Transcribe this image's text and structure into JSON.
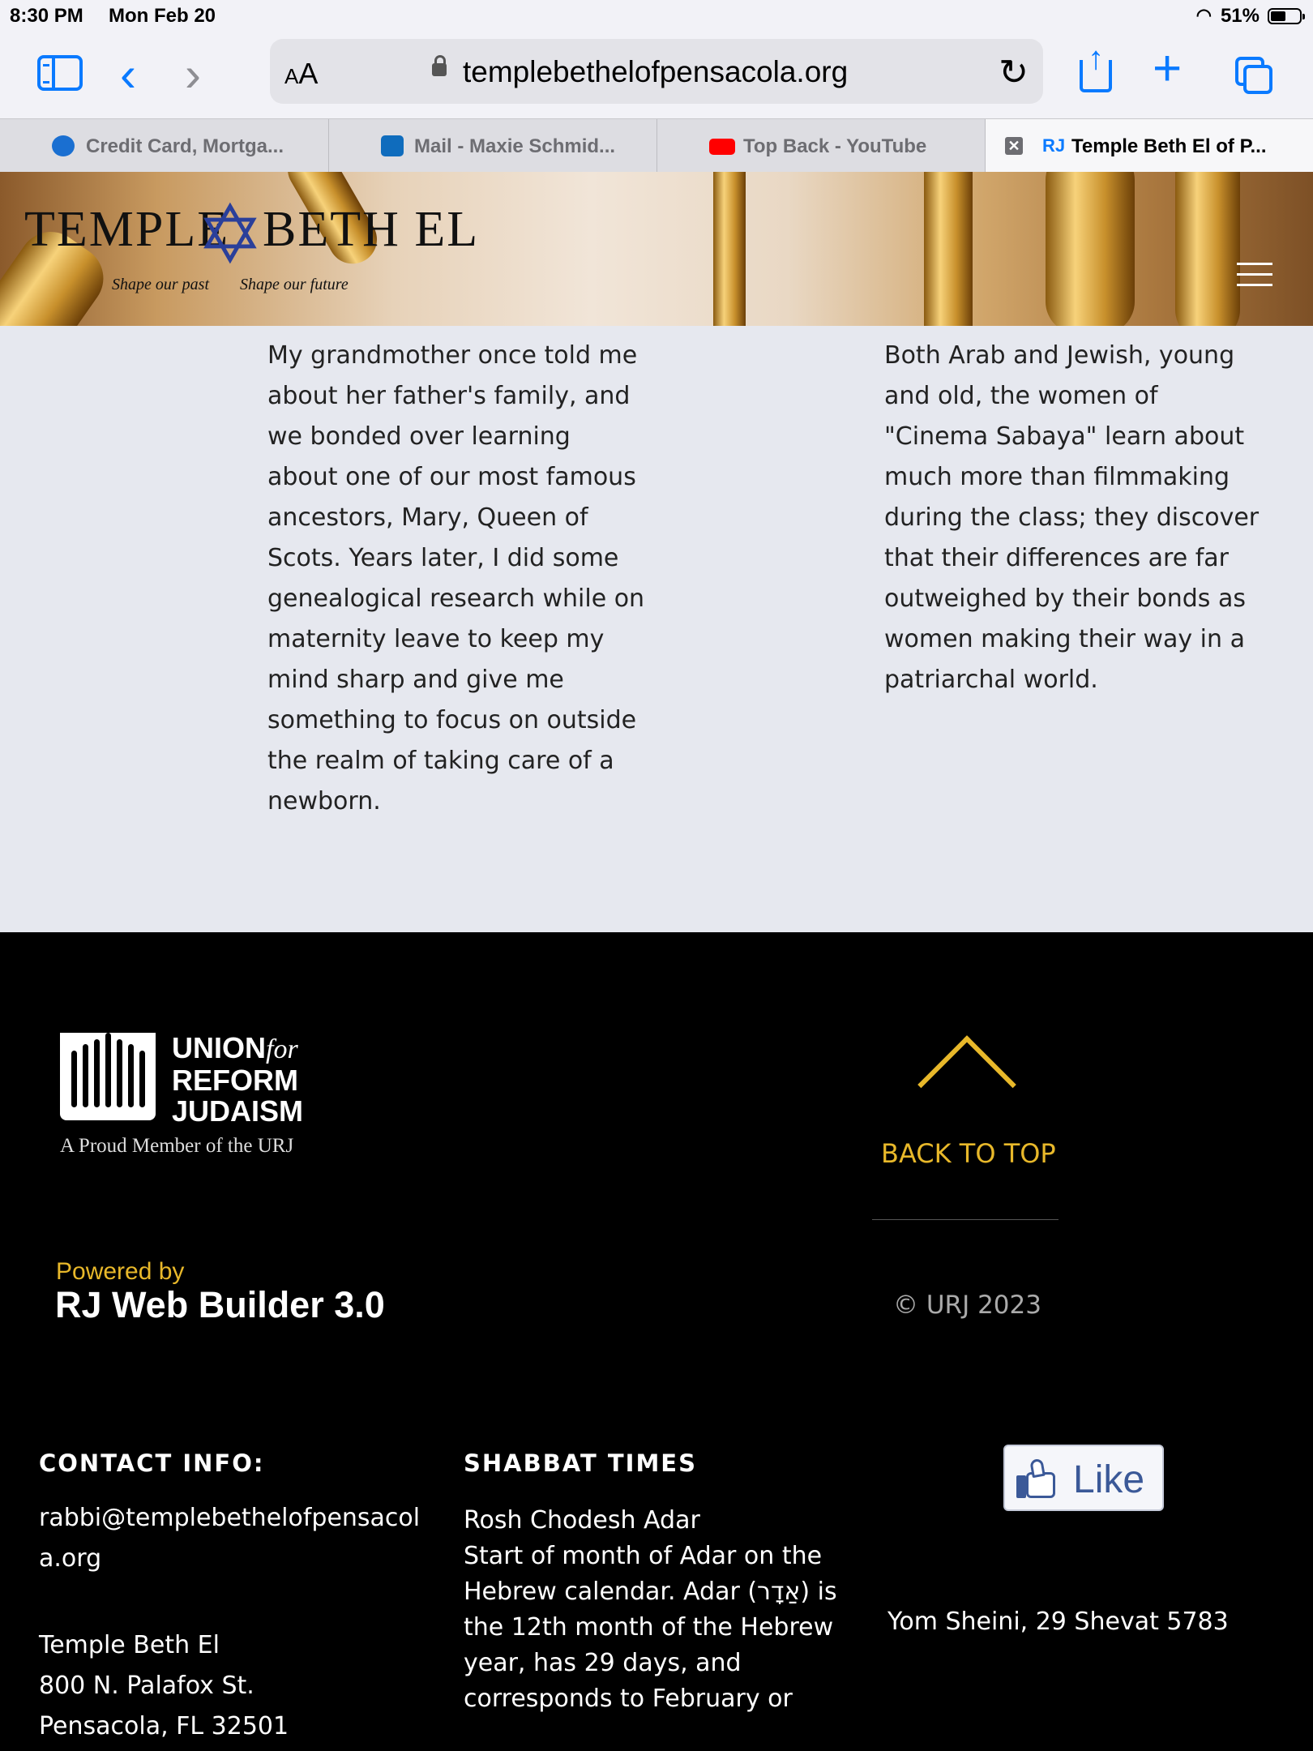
{
  "status_bar": {
    "time": "8:30 PM",
    "date": "Mon Feb 20",
    "battery": "51%",
    "battery_level": 0.51
  },
  "browser": {
    "aa_label_big": "A",
    "aa_label_small": "A",
    "url": "templebethelofpensacola.org",
    "tabs": [
      {
        "label": "Credit Card, Mortga...",
        "icon": "chase-icon"
      },
      {
        "label": "Mail - Maxie Schmid...",
        "icon": "outlook-icon"
      },
      {
        "label": "Top Back - YouTube",
        "icon": "youtube-icon"
      },
      {
        "label": "Temple Beth El of P...",
        "icon": "rj-icon",
        "favicon_text": "RJ",
        "active": true
      }
    ]
  },
  "site": {
    "logo_left": "TEMPLE",
    "logo_right": "BETH EL",
    "tagline_left": "Shape our past",
    "tagline_right": "Shape our future"
  },
  "content": {
    "left_column": [
      "My grandmother once told me",
      "about her father's family, and",
      "we bonded over learning",
      "about one of our most famous",
      "ancestors, Mary, Queen of",
      "Scots. Years later, I did some",
      "genealogical research while on",
      "maternity leave to keep my",
      "mind sharp and give me",
      "something to focus on outside",
      "the realm of taking care of a",
      "newborn."
    ],
    "right_column": [
      "Both Arab and Jewish, young",
      "and old, the women of",
      "\"Cinema Sabaya\" learn about",
      "much more than filmmaking",
      "during the class; they discover",
      "that their differences are far",
      "outweighed by their bonds as",
      "women making their way in a",
      "patriarchal world."
    ]
  },
  "footer": {
    "urj": {
      "line1": "UNION",
      "line1_for": "for",
      "line2": "REFORM",
      "line3": "JUDAISM",
      "member": "A Proud Member of the URJ"
    },
    "back_to_top": "BACK TO TOP",
    "copyright": "© URJ 2023",
    "powered_by": "Powered by",
    "builder": "RJ Web Builder 3.0",
    "contact": {
      "heading": "CONTACT INFO:",
      "email_line1": "rabbi@templebethelofpensacol",
      "email_line2": "a.org",
      "address": [
        "Temple Beth El",
        "800 N. Palafox St.",
        "Pensacola, FL 32501"
      ]
    },
    "shabbat": {
      "heading": "SHABBAT TIMES",
      "lines": [
        "Rosh Chodesh Adar",
        "Start of month of Adar on the",
        "Hebrew calendar. Adar (אַדָר) is",
        "the 12th month of the Hebrew",
        "year, has 29 days, and",
        "corresponds to February or"
      ]
    },
    "like_label": "Like",
    "hebrew_date": "Yom Sheini, 29 Shevat 5783"
  }
}
